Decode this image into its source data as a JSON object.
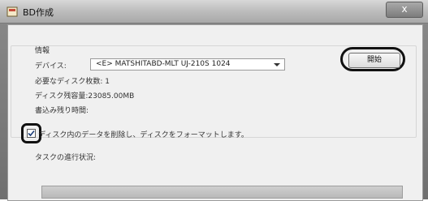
{
  "window": {
    "title": "BD作成",
    "close_symbol": "x"
  },
  "info": {
    "group_label": "情報",
    "device_label": "デバイス:",
    "device_value": "<E> MATSHITABD-MLT UJ-210S 1024",
    "discs_needed_label": "必要なディスク枚数: 1",
    "disc_remaining_label": "ディスク残容量:23085.00MB",
    "time_remaining_label": "書込み残り時間:"
  },
  "actions": {
    "start_label": "開始"
  },
  "options": {
    "format_checkbox_label": "ディスク内のデータを削除し、ディスクをフォーマットします。",
    "format_checked": true
  },
  "progress": {
    "label": "タスクの進行状況:",
    "value": 0
  }
}
